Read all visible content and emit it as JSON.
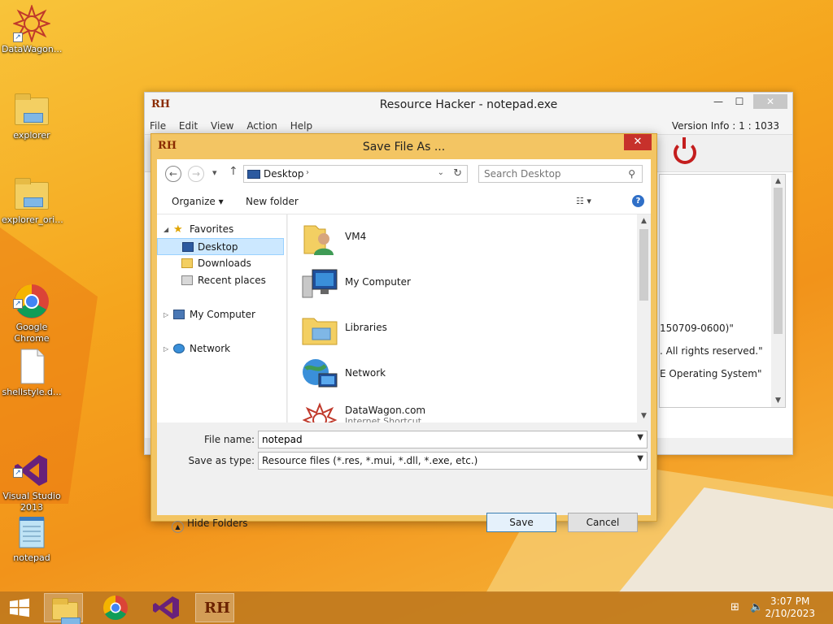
{
  "desktop": {
    "icons": [
      {
        "label": "DataWagon..."
      },
      {
        "label": "explorer"
      },
      {
        "label": "explorer_ori..."
      },
      {
        "label": "Google\nChrome"
      },
      {
        "label": "shellstyle.d..."
      },
      {
        "label": "Visual Studio\n2013"
      },
      {
        "label": "notepad"
      }
    ]
  },
  "main_window": {
    "logo": "RH",
    "title": "Resource Hacker - notepad.exe",
    "menu": [
      "File",
      "Edit",
      "View",
      "Action",
      "Help"
    ],
    "version_info": "Version Info : 1 : 1033",
    "editor_lines": [
      "150709-0600)\"",
      ". All rights reserved.\"",
      "E Operating System\""
    ]
  },
  "dialog": {
    "logo": "RH",
    "title": "Save File As ...",
    "address": "Desktop",
    "search_placeholder": "Search Desktop",
    "organize": "Organize",
    "new_folder": "New folder",
    "nav": {
      "favorites": "Favorites",
      "desktop": "Desktop",
      "downloads": "Downloads",
      "recent": "Recent places",
      "my_computer": "My Computer",
      "network": "Network"
    },
    "items": [
      {
        "name": "VM4",
        "sub": ""
      },
      {
        "name": "My Computer",
        "sub": ""
      },
      {
        "name": "Libraries",
        "sub": ""
      },
      {
        "name": "Network",
        "sub": ""
      },
      {
        "name": "DataWagon.com",
        "sub": "Internet Shortcut"
      }
    ],
    "file_name_label": "File name:",
    "file_name_value": "notepad",
    "save_type_label": "Save as type:",
    "save_type_value": "Resource files (*.res, *.mui, *.dll, *.exe, etc.)",
    "save_label": "Save",
    "cancel_label": "Cancel",
    "hide_folders": "Hide Folders"
  },
  "taskbar": {
    "time": "3:07 PM",
    "date": "2/10/2023",
    "rh_label": "RH"
  }
}
